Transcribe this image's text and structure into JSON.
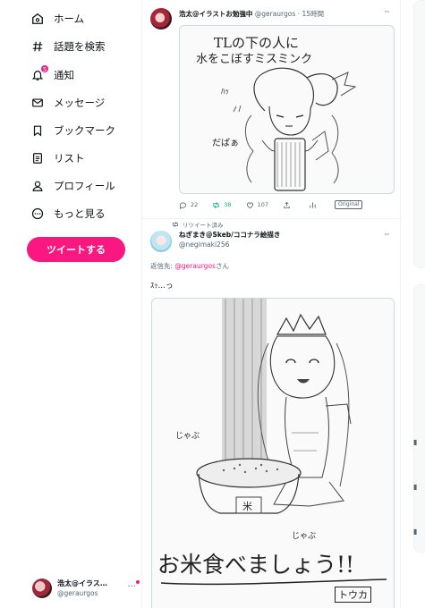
{
  "sidebar": {
    "items": [
      {
        "label": "ホーム",
        "icon": "home-icon"
      },
      {
        "label": "話題を検索",
        "icon": "hashtag-icon"
      },
      {
        "label": "通知",
        "icon": "bell-icon",
        "badge": "5"
      },
      {
        "label": "メッセージ",
        "icon": "mail-icon"
      },
      {
        "label": "ブックマーク",
        "icon": "bookmark-icon"
      },
      {
        "label": "リスト",
        "icon": "list-icon"
      },
      {
        "label": "プロフィール",
        "icon": "person-icon"
      },
      {
        "label": "もっと見る",
        "icon": "more-circle-icon"
      }
    ],
    "tweet_button": "ツイートする",
    "account": {
      "name": "浩太@イラス…",
      "handle": "@geraurgos",
      "more": "···"
    }
  },
  "tweets": [
    {
      "name": "浩太@イラストお勉強中",
      "handle": "@geraurgos",
      "time": "· 15時間",
      "more": "···",
      "sketch_text": {
        "line1": "TLの下の人に",
        "line2": "水をこぼすミスミンク",
        "sfx1": "ﾊｯ",
        "sfx2": "だばぁ"
      },
      "actions": {
        "reply": "22",
        "retweet": "38",
        "like": "107",
        "original_badge": "Original"
      },
      "colors": {
        "retweet_active": "#00ba7c"
      }
    },
    {
      "retweeted_label": "リツイート済み",
      "name": "ねぎまき@Skeb/ココナラ絵描き",
      "handle": "@negimaki256",
      "more": "···",
      "reply_prefix": "返信先: ",
      "reply_mention": "@geraurgos",
      "reply_suffix": "さん",
      "text": "ｽｯ…っ",
      "sketch_text": {
        "rice": "米",
        "sfx1": "じゃぶ",
        "sfx2": "じゃぶ",
        "main": "お米食べましょう!!",
        "sign": "トウカ"
      }
    }
  ],
  "colors": {
    "accent": "#f91880",
    "text": "#0f1419",
    "secondary": "#536471",
    "border": "#cfd9de"
  }
}
